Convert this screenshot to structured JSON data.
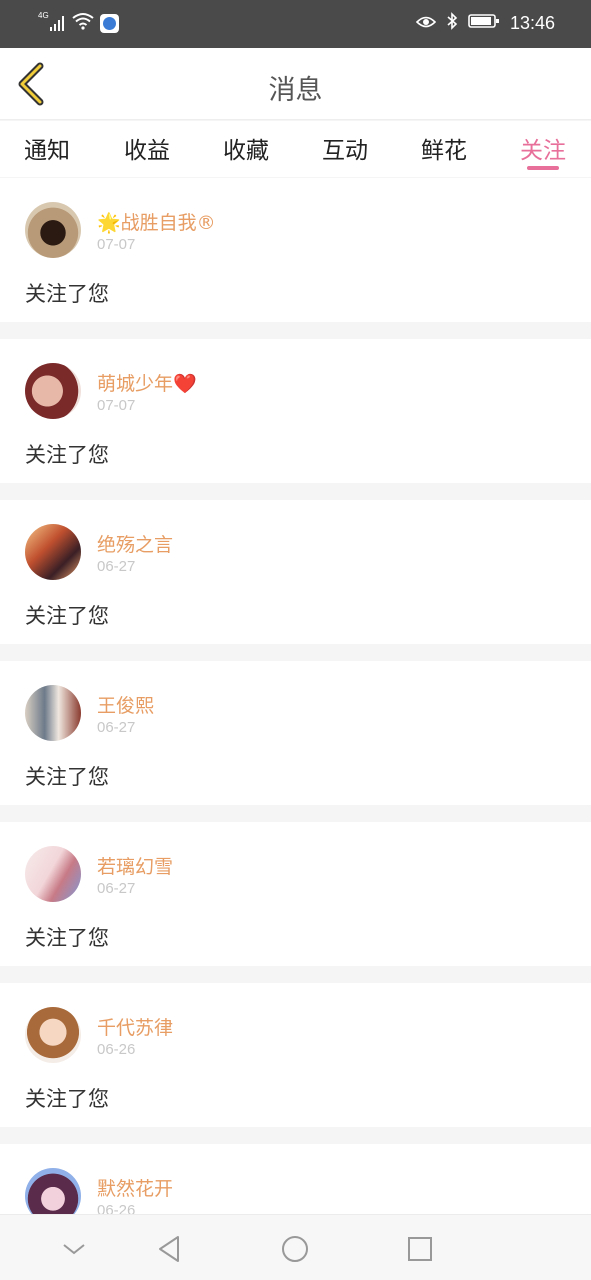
{
  "status_bar": {
    "signal_label": "4G",
    "time": "13:46",
    "icons": [
      "signal-icon",
      "wifi-icon",
      "baidu-app-icon",
      "eye-icon",
      "bluetooth-icon",
      "battery-icon"
    ]
  },
  "header": {
    "title": "消息",
    "back_icon": "chevron-left-icon"
  },
  "tabs": [
    {
      "label": "通知",
      "active": false
    },
    {
      "label": "收益",
      "active": false
    },
    {
      "label": "收藏",
      "active": false
    },
    {
      "label": "互动",
      "active": false
    },
    {
      "label": "鲜花",
      "active": false
    },
    {
      "label": "关注",
      "active": true
    }
  ],
  "colors": {
    "accent": "#e76f9a",
    "username": "#e79d63",
    "date": "#c8c8c8",
    "status_bar": "#4a4a4a"
  },
  "notifications": [
    {
      "name": "🌟战胜自我®",
      "date": "07-07",
      "message": "关注了您"
    },
    {
      "name": "萌城少年❤️",
      "date": "07-07",
      "message": "关注了您"
    },
    {
      "name": "绝殇之言",
      "date": "06-27",
      "message": "关注了您"
    },
    {
      "name": "王俊熙",
      "date": "06-27",
      "message": "关注了您"
    },
    {
      "name": "若璃幻雪",
      "date": "06-27",
      "message": "关注了您"
    },
    {
      "name": "千代苏律",
      "date": "06-26",
      "message": "关注了您"
    },
    {
      "name": "默然花开",
      "date": "06-26",
      "message": ""
    }
  ],
  "nav_bar": {
    "icons": [
      "collapse-icon",
      "back-triangle-icon",
      "home-circle-icon",
      "recent-square-icon"
    ]
  }
}
